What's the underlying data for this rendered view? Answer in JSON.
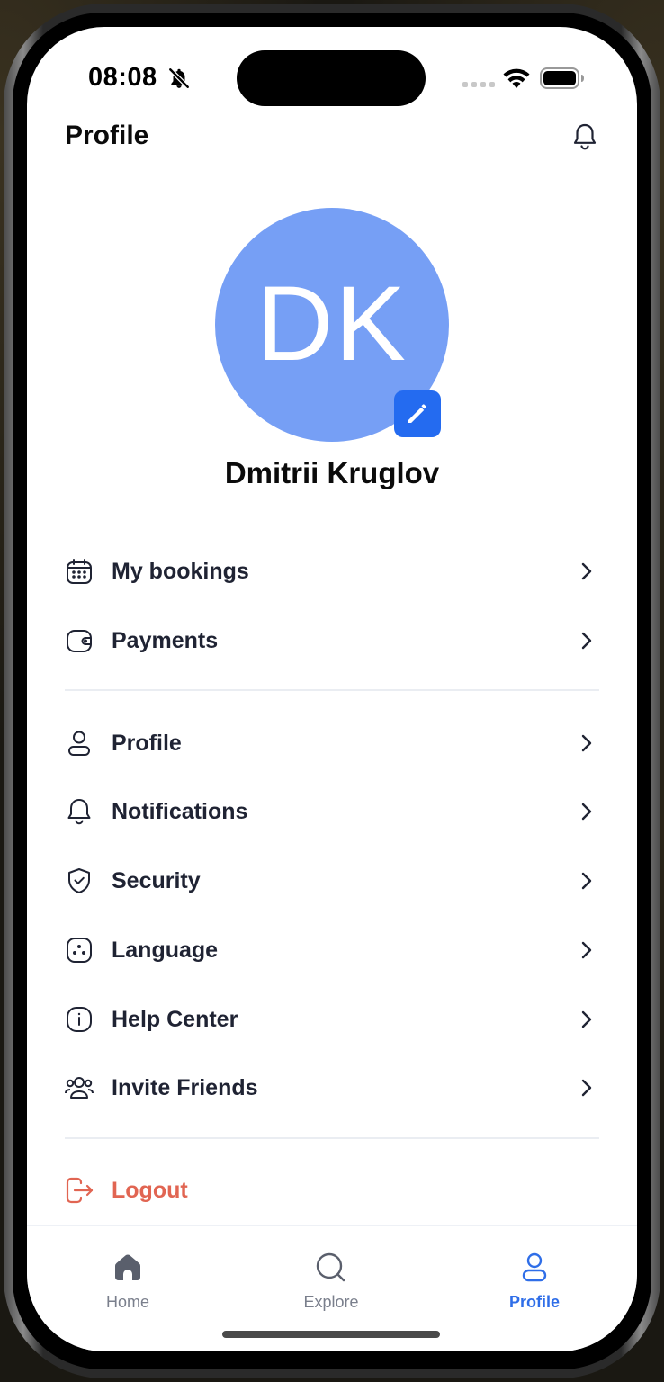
{
  "status_bar": {
    "time": "08:08"
  },
  "header": {
    "title": "Profile"
  },
  "profile": {
    "initials": "DK",
    "name": "Dmitrii Kruglov",
    "avatar_color": "#769ff5"
  },
  "menu_group_1": [
    {
      "label": "My bookings",
      "icon": "calendar-icon"
    },
    {
      "label": "Payments",
      "icon": "wallet-icon"
    }
  ],
  "menu_group_2": [
    {
      "label": "Profile",
      "icon": "user-icon"
    },
    {
      "label": "Notifications",
      "icon": "bell-icon"
    },
    {
      "label": "Security",
      "icon": "shield-icon"
    },
    {
      "label": "Language",
      "icon": "language-icon"
    },
    {
      "label": "Help Center",
      "icon": "info-icon"
    },
    {
      "label": "Invite Friends",
      "icon": "users-icon"
    }
  ],
  "logout": {
    "label": "Logout",
    "color": "#e16552"
  },
  "tabbar": {
    "tabs": [
      {
        "label": "Home",
        "icon": "home-icon",
        "active": false
      },
      {
        "label": "Explore",
        "icon": "search-icon",
        "active": false
      },
      {
        "label": "Profile",
        "icon": "user-icon",
        "active": true
      }
    ],
    "active_color": "#2f6ee8"
  }
}
